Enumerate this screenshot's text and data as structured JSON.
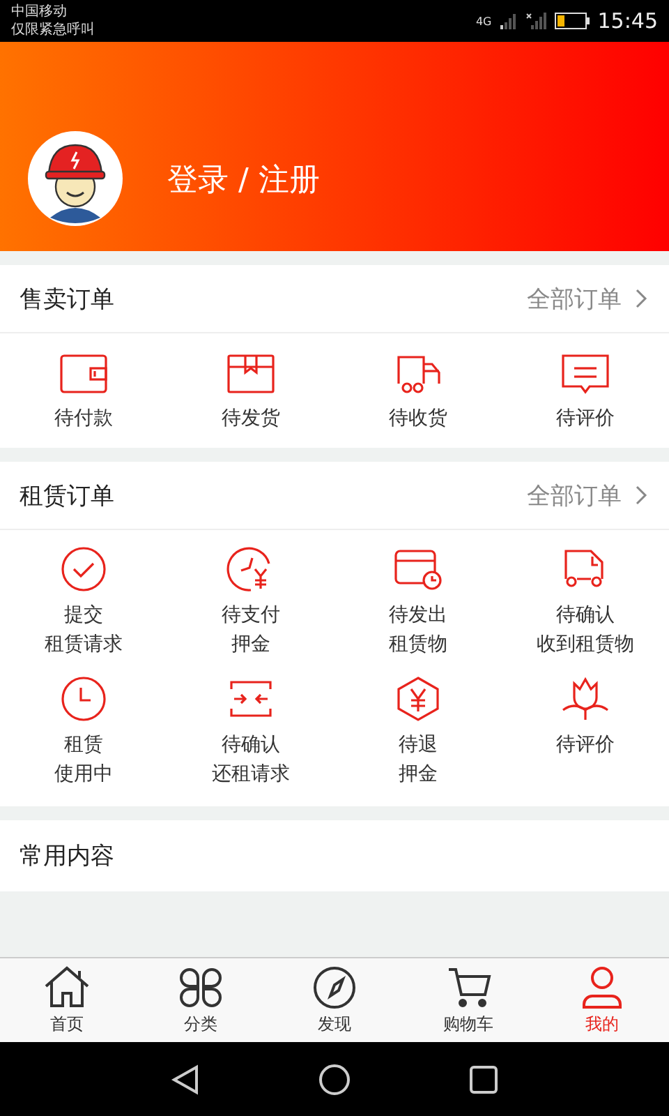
{
  "status_bar": {
    "carrier": "中国移动",
    "notice": "仅限紧急呼叫",
    "network": "4G",
    "time": "15:45"
  },
  "profile": {
    "login_text": "登录 / 注册"
  },
  "sale_orders": {
    "title": "售卖订单",
    "all_link": "全部订单",
    "items": [
      {
        "label": [
          "待付款"
        ]
      },
      {
        "label": [
          "待发货"
        ]
      },
      {
        "label": [
          "待收货"
        ]
      },
      {
        "label": [
          "待评价"
        ]
      }
    ]
  },
  "rental_orders": {
    "title": "租赁订单",
    "all_link": "全部订单",
    "items": [
      {
        "label": [
          "提交",
          "租赁请求"
        ]
      },
      {
        "label": [
          "待支付",
          "押金"
        ]
      },
      {
        "label": [
          "待发出",
          "租赁物"
        ]
      },
      {
        "label": [
          "待确认",
          "收到租赁物"
        ]
      },
      {
        "label": [
          "租赁",
          "使用中"
        ]
      },
      {
        "label": [
          "待确认",
          "还租请求"
        ]
      },
      {
        "label": [
          "待退",
          "押金"
        ]
      },
      {
        "label": [
          "待评价"
        ]
      }
    ]
  },
  "common": {
    "title": "常用内容"
  },
  "tab_bar": [
    {
      "label": "首页",
      "selected": false
    },
    {
      "label": "分类",
      "selected": false
    },
    {
      "label": "发现",
      "selected": false
    },
    {
      "label": "购物车",
      "selected": false
    },
    {
      "label": "我的",
      "selected": true
    }
  ]
}
